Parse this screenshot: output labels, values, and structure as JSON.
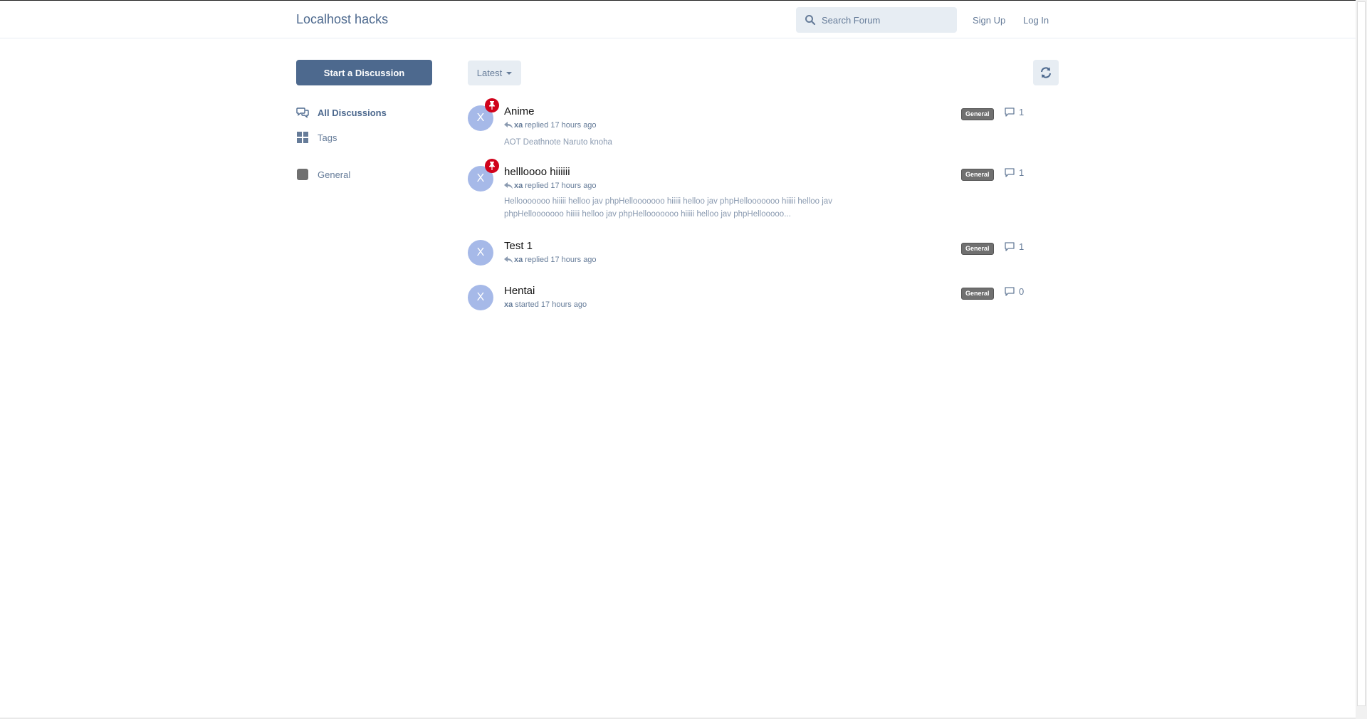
{
  "header": {
    "brand": "Localhost hacks",
    "search_placeholder": "Search Forum",
    "signup_label": "Sign Up",
    "login_label": "Log In"
  },
  "sidebar": {
    "start_label": "Start a Discussion",
    "items": [
      {
        "label": "All Discussions",
        "icon": "comments-icon",
        "active": true
      },
      {
        "label": "Tags",
        "icon": "grid-icon"
      },
      {
        "label": "General",
        "icon": "tag-square-icon",
        "color": "#707070"
      }
    ]
  },
  "toolbar": {
    "sort_label": "Latest"
  },
  "discussions": [
    {
      "title": "Anime",
      "avatar_letter": "X",
      "pinned": true,
      "user": "xa",
      "meta_text": "replied 17 hours ago",
      "excerpt": "AOT Deathnote Naruto knoha",
      "tag": "General",
      "replies": "1"
    },
    {
      "title": "hellloooo hiiiiii",
      "avatar_letter": "X",
      "pinned": true,
      "user": "xa",
      "meta_text": "replied 17 hours ago",
      "excerpt": "Hellooooooo hiiiii helloo jav phpHellooooooo hiiiii helloo jav phpHellooooooo hiiiii helloo jav phpHellooooooo hiiiii helloo jav phpHellooooooo hiiiii helloo jav phpHellooooo...",
      "tag": "General",
      "replies": "1"
    },
    {
      "title": "Test 1",
      "avatar_letter": "X",
      "pinned": false,
      "user": "xa",
      "meta_text": "replied 17 hours ago",
      "excerpt": "",
      "tag": "General",
      "replies": "1"
    },
    {
      "title": "Hentai",
      "avatar_letter": "X",
      "pinned": false,
      "user": "xa",
      "meta_text": "started 17 hours ago",
      "excerpt": "",
      "tag": "General",
      "replies": "0"
    }
  ],
  "colors": {
    "primary": "#4d698e",
    "secondary_bg": "#e7edf3",
    "avatar_bg": "#a6b9e8",
    "pin": "#d0021b",
    "tag_general": "#707070"
  }
}
